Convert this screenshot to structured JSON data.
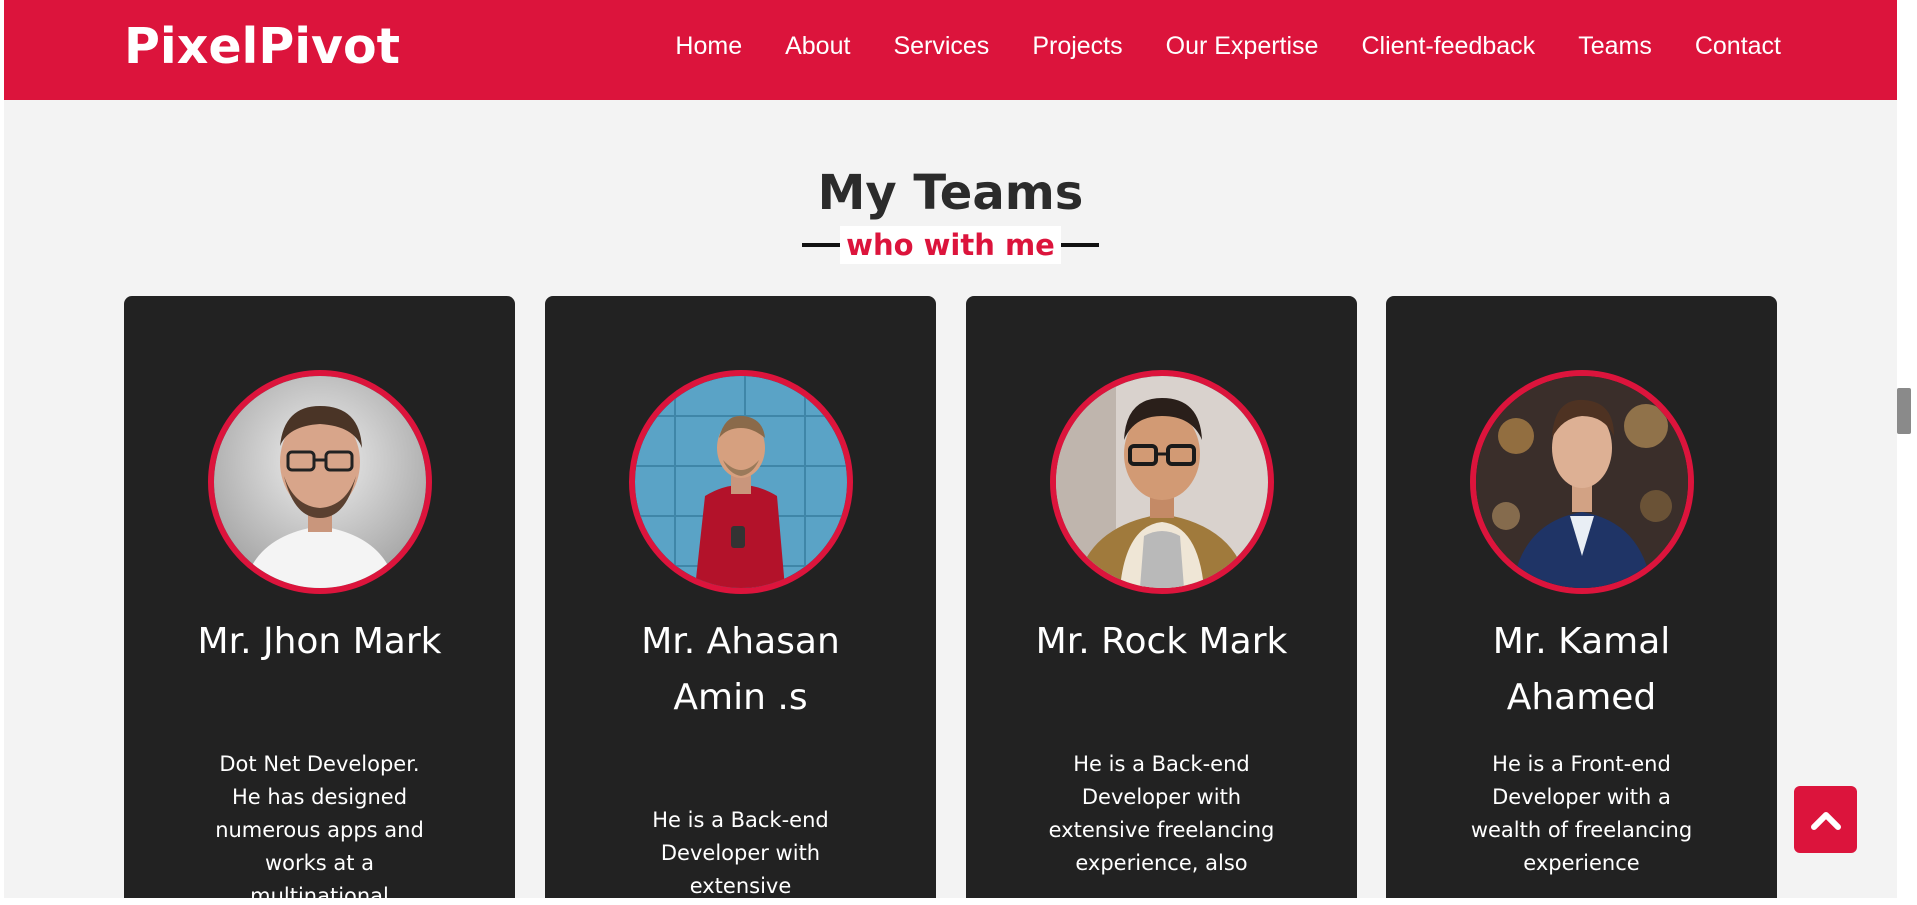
{
  "brand": {
    "name": "PixelPivot",
    "accent": "#dc143c"
  },
  "nav": {
    "items": [
      {
        "label": "Home"
      },
      {
        "label": "About"
      },
      {
        "label": "Services"
      },
      {
        "label": "Projects"
      },
      {
        "label": "Our Expertise"
      },
      {
        "label": "Client-feedback"
      },
      {
        "label": "Teams"
      },
      {
        "label": "Contact"
      }
    ]
  },
  "teams": {
    "title": "My Teams",
    "subtitle": "who with me",
    "members": [
      {
        "name": "Mr. Jhon Mark",
        "description": "Dot Net Developer. He has designed numerous apps and works at a multinational",
        "photo": "portrait-man-glasses-grey-background"
      },
      {
        "name": "Mr. Ahasan Amin .s",
        "description": "He is a Back-end Developer with extensive",
        "photo": "portrait-man-red-sweater-blue-wall"
      },
      {
        "name": "Mr. Rock Mark",
        "description": "He is a Back-end Developer with extensive freelancing experience, also",
        "photo": "portrait-man-glasses-shearling-jacket"
      },
      {
        "name": "Mr. Kamal Ahamed",
        "description": "He is a Front-end Developer with a wealth of freelancing experience",
        "photo": "portrait-man-navy-suit-city-lights"
      }
    ]
  },
  "back_to_top": {
    "icon": "chevron-up-icon"
  }
}
